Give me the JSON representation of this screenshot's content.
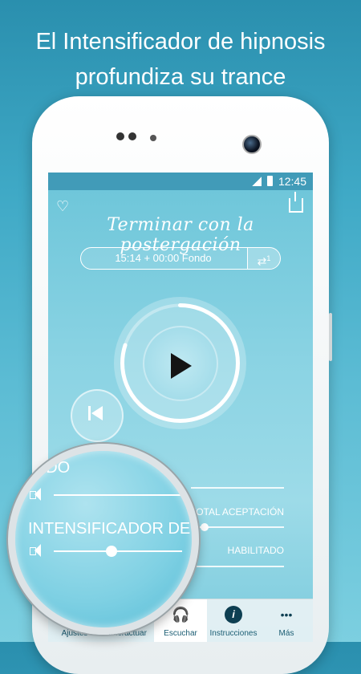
{
  "headline": {
    "line1": "El Intensificador de hipnosis",
    "line2": "profundiza su trance"
  },
  "status_bar": {
    "time": "12:45"
  },
  "player": {
    "title": "Terminar con la postergación",
    "time_display": "15:14 + 00:00 Fondo",
    "repeat_badge": "1",
    "progress_fraction": 0.8
  },
  "mixer": {
    "fondo_label": "FONDO",
    "total_label": "TOTAL ACEPTACIÓN",
    "enhancer_label": "INTENSIFICADOR DE HIPNOSIS",
    "enhancer_label_visible": "INTENSIFICADOR DE HIPNO",
    "enabled_label": "HABILITADO",
    "fondo_level": 0.0,
    "enhancer_level": 0.45
  },
  "tabs": [
    {
      "label": "Ajustes",
      "icon": "settings-icon"
    },
    {
      "label": "Interactuar",
      "icon": "interact-icon"
    },
    {
      "label": "Escuchar",
      "icon": "headphones-icon",
      "active": true
    },
    {
      "label": "Instrucciones",
      "icon": "info-icon",
      "glyph": "i"
    },
    {
      "label": "Más",
      "icon": "more-icon",
      "glyph": "•••"
    }
  ],
  "colors": {
    "accent": "#2a8fae",
    "icon_dark": "#0e3f52"
  }
}
